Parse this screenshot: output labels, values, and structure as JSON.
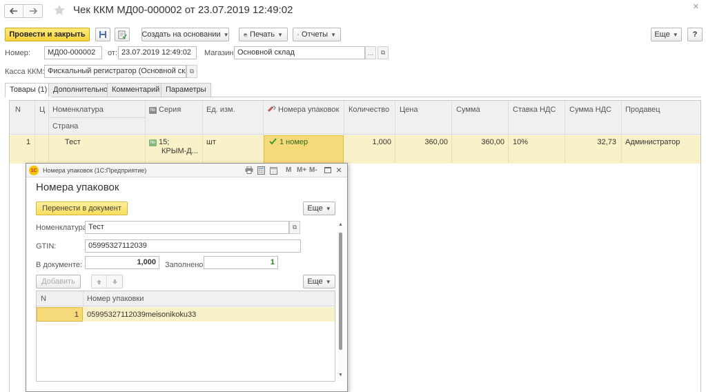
{
  "window": {
    "title": "Чек ККМ МД00-000002 от 23.07.2019 12:49:02",
    "close_glyph": "×"
  },
  "toolbar": {
    "post_close": "Провести и закрыть",
    "create_based": "Создать на основании",
    "print": "Печать",
    "reports": "Отчеты",
    "more": "Еще",
    "help": "?"
  },
  "header": {
    "number_label": "Номер:",
    "number_value": "МД00-000002",
    "date_label": "от:",
    "date_value": "23.07.2019 12:49:02",
    "store_label": "Магазин:",
    "store_value": "Основной склад",
    "register_label": "Касса ККМ:",
    "register_value": "Фискальный регистратор (Основной склад)"
  },
  "tabs": [
    "Товары (1)",
    "Дополнительно",
    "Комментарий",
    "Параметры"
  ],
  "table": {
    "columns": {
      "n": "N",
      "c": "Ц",
      "nomenclature": "Номенклатура",
      "country": "Страна",
      "series": "Серия",
      "unit": "Ед. изм.",
      "package_numbers": "Номера упаковок",
      "quantity": "Количество",
      "price": "Цена",
      "sum": "Сумма",
      "vat_rate": "Ставка НДС",
      "vat_sum": "Сумма НДС",
      "seller": "Продавец"
    },
    "rows": [
      {
        "n": "1",
        "nomenclature": "Тест",
        "series_line1": "15;",
        "series_line2": "КРЫМ-Д...",
        "unit": "шт",
        "package_numbers": "1 номер",
        "quantity": "1,000",
        "price": "360,00",
        "sum": "360,00",
        "vat_rate": "10%",
        "vat_sum": "32,73",
        "seller": "Администратор"
      }
    ]
  },
  "dialog": {
    "window_title": "Номера упаковок  (1С:Предприятие)",
    "logo": "1С",
    "tb_m": "M",
    "tb_mplus": "M+",
    "tb_mminus": "M-",
    "heading": "Номера упаковок",
    "transfer_button": "Перенести в документ",
    "more": "Еще",
    "nomenclature_label": "Номенклатура:",
    "nomenclature_value": "Тест",
    "gtin_label": "GTIN:",
    "gtin_value": "05995327112039",
    "in_doc_label": "В документе:",
    "in_doc_value": "1,000",
    "filled_label": "Заполнено:",
    "filled_value": "1",
    "add_button": "Добавить",
    "more2": "Еще",
    "table": {
      "col_n": "N",
      "col_package": "Номер упаковки",
      "rows": [
        {
          "n": "1",
          "package": "05995327112039meisonikoku33"
        }
      ]
    }
  }
}
